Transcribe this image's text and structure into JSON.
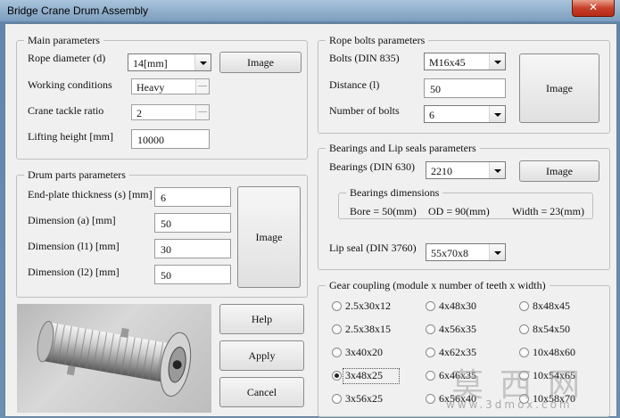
{
  "window": {
    "title": "Bridge Crane Drum Assembly",
    "close_glyph": "✕"
  },
  "main_params": {
    "legend": "Main parameters",
    "rope_diameter_label": "Rope diameter (d)",
    "rope_diameter_value": "14[mm]",
    "image_button": "Image",
    "working_conditions_label": "Working conditions",
    "working_conditions_value": "Heavy",
    "tackle_ratio_label": "Crane tackle ratio",
    "tackle_ratio_value": "2",
    "lifting_height_label": "Lifting height [mm]",
    "lifting_height_value": "10000"
  },
  "drum_parts": {
    "legend": "Drum parts parameters",
    "endplate_label": "End-plate thickness (s) [mm]",
    "endplate_value": "6",
    "dim_a_label": "Dimension (a) [mm]",
    "dim_a_value": "50",
    "dim_l1_label": "Dimension (l1) [mm]",
    "dim_l1_value": "30",
    "dim_l2_label": "Dimension (l2) [mm]",
    "dim_l2_value": "50",
    "image_button": "Image"
  },
  "rope_bolts": {
    "legend": "Rope bolts parameters",
    "bolts_label": "Bolts (DIN 835)",
    "bolts_value": "M16x45",
    "distance_label": "Distance (l)",
    "distance_value": "50",
    "number_label": "Number of bolts",
    "number_value": "6",
    "image_button": "Image"
  },
  "bearings": {
    "legend": "Bearings and Lip seals parameters",
    "bearings_label": "Bearings (DIN 630)",
    "bearings_value": "2210",
    "image_button": "Image",
    "dims_legend": "Bearings dimensions",
    "bore": "Bore = 50(mm)",
    "od": "OD = 90(mm)",
    "width": "Width = 23(mm)",
    "lipseal_label": "Lip seal  (DIN 3760)",
    "lipseal_value": "55x70x8"
  },
  "actions": {
    "help": "Help",
    "apply": "Apply",
    "cancel": "Cancel"
  },
  "gear_coupling": {
    "legend": "Gear coupling (module x number of teeth x width)",
    "selected": "3x48x25",
    "col1": [
      "2.5x30x12",
      "2.5x38x15",
      "3x40x20",
      "3x48x25",
      "3x56x25"
    ],
    "col2": [
      "4x48x30",
      "4x56x35",
      "4x62x35",
      "6x46x35",
      "6x56x40"
    ],
    "col3": [
      "8x48x45",
      "8x54x50",
      "10x48x60",
      "10x54x65",
      "10x58x70"
    ]
  },
  "watermark": {
    "glyphs": "莫西网",
    "site": "www.3dmox.com"
  },
  "colors": {
    "close_button": "#c8402a",
    "dialog_bg": "#f0f0f0"
  }
}
